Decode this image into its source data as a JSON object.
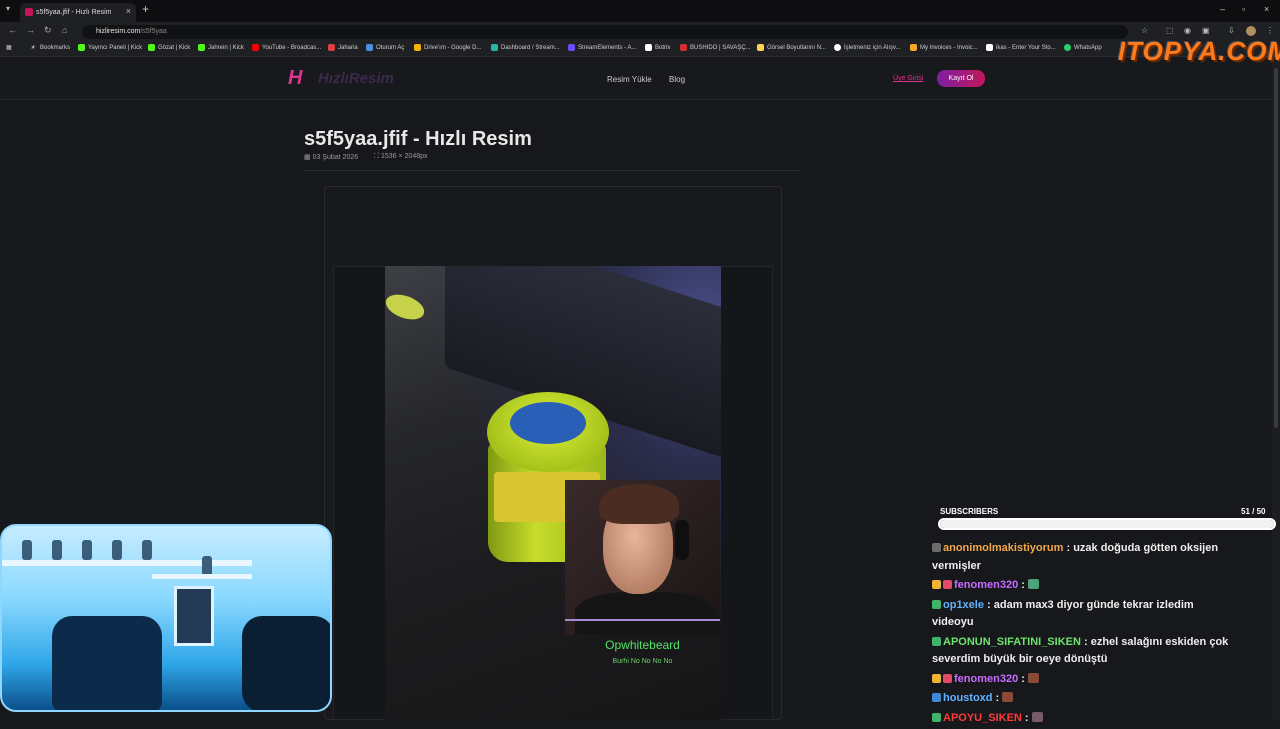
{
  "browser": {
    "tab_title": "s5f5yaa.jfif - Hızlı Resim",
    "url_host": "hizliresim.com",
    "url_path": "/s5f5yaa",
    "bookmarks": [
      {
        "label": "Bookmarks",
        "color": "#aaaaaa"
      },
      {
        "label": "Yayıncı Paneli | Kick",
        "color": "#53fc18"
      },
      {
        "label": "Gözat | Kick",
        "color": "#53fc18"
      },
      {
        "label": "Jahrein | Kick",
        "color": "#53fc18"
      },
      {
        "label": "YouTube - Broadcas...",
        "color": "#ff0000"
      },
      {
        "label": "Jaharia",
        "color": "#e04040"
      },
      {
        "label": "Oturum Aç",
        "color": "#4a90e2"
      },
      {
        "label": "Drive'ım - Google D...",
        "color": "#f4b400"
      },
      {
        "label": "Dashboard / Stream...",
        "color": "#2bb3a3"
      },
      {
        "label": "StreamElements - A...",
        "color": "#6a4cff"
      },
      {
        "label": "Botrix",
        "color": "#ffffff"
      },
      {
        "label": "BUSHIDO | SAVAŞÇ...",
        "color": "#d32f2f"
      },
      {
        "label": "Görsel Boyutlarını N...",
        "color": "#ffd54f"
      },
      {
        "label": "İşletmeniz için Alışv...",
        "color": "#ffffff"
      },
      {
        "label": "My Invoices - Invoic...",
        "color": "#f9a825"
      },
      {
        "label": "ikas - Enter Your Sto...",
        "color": "#ffffff"
      },
      {
        "label": "WhatsApp",
        "color": "#25d366"
      }
    ]
  },
  "site": {
    "logo_text": "HızlıResim",
    "nav": [
      "Resim Yükle",
      "Blog"
    ],
    "login": "Üye Girişi",
    "register": "Kayıt Ol"
  },
  "image_page": {
    "title": "s5f5yaa.jfif - Hızlı Resim",
    "date": "03 Şubat 2026",
    "dimensions": "1536 × 2048px"
  },
  "overlay": {
    "watermark": "ITOPYA.COM",
    "cam_name": "Opwhitebeard",
    "cam_subtitle": "Burhi No No No No",
    "subscribers_label": "SUBSCRIBERS",
    "subscribers_current": 51,
    "subscribers_goal": 50,
    "subscribers_text": "51  / 50",
    "subscribers_fraction": 1.0
  },
  "chat": [
    {
      "user": "anonimolmakistiyorum",
      "color": "#f0a84a",
      "badges": [
        "#6b6b6b"
      ],
      "text": "uzak doğuda götten oksijen vermişler"
    },
    {
      "user": "fenomen320",
      "color": "#c86cff",
      "badges": [
        "#f2b233",
        "#e24a6a"
      ],
      "text": "",
      "emote": "#4aa37a"
    },
    {
      "user": "op1xele",
      "color": "#61b2ff",
      "badges": [
        "#3fb36a"
      ],
      "text": "adam max3 diyor günde tekrar izledim videoyu"
    },
    {
      "user": "APONUN_SIFATINI_SIKEN",
      "color": "#6ee36e",
      "badges": [
        "#3fb36a"
      ],
      "text": "ezhel salağını eskiden çok severdim büyük bir oeye dönüştü"
    },
    {
      "user": "fenomen320",
      "color": "#c86cff",
      "badges": [
        "#f2b233",
        "#e24a6a"
      ],
      "text": "",
      "emote": "#8a4a3a"
    },
    {
      "user": "houstoxd",
      "color": "#61b2ff",
      "badges": [
        "#3f8ad6"
      ],
      "text": "",
      "emote": "#8a4a3a"
    },
    {
      "user": "APOYU_SIKEN",
      "color": "#ff3a3a",
      "badges": [
        "#3fb36a"
      ],
      "text": "",
      "emote": "#7a5a6a"
    }
  ]
}
